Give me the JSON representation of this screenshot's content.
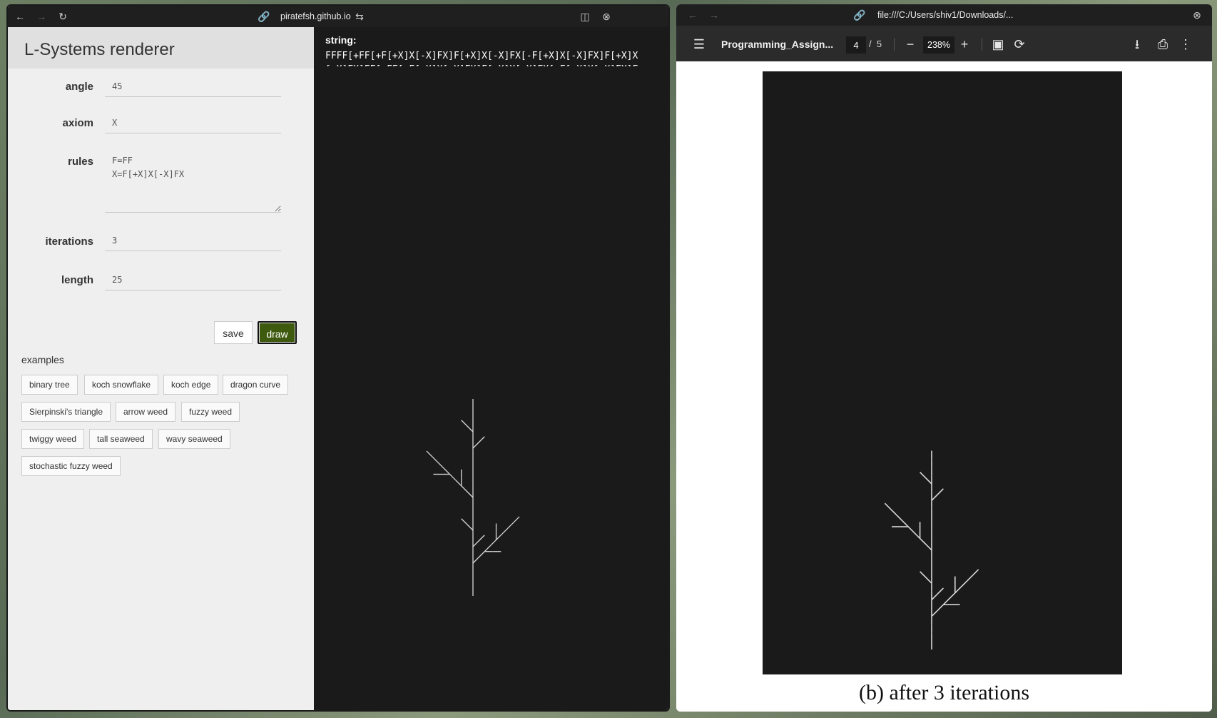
{
  "left_window": {
    "url": "piratefsh.github.io",
    "icons": [
      "back-arrow-icon",
      "forward-arrow-icon",
      "reload-icon",
      "link-icon",
      "tune-icon",
      "split-view-icon",
      "close-circle-icon"
    ]
  },
  "app": {
    "title": "L-Systems renderer",
    "angle": {
      "label": "angle",
      "value": "45"
    },
    "axiom": {
      "label": "axiom",
      "value": "X"
    },
    "rules": {
      "label": "rules",
      "value": "F=FF\nX=F[+X]X[-X]FX"
    },
    "iterations": {
      "label": "iterations",
      "value": "3"
    },
    "length": {
      "label": "length",
      "value": "25"
    },
    "save_label": "save",
    "draw_label": "draw",
    "examples_label": "examples",
    "examples": [
      "binary tree",
      "koch snowflake",
      "koch edge",
      "dragon curve",
      "Sierpinski's triangle",
      "arrow weed",
      "fuzzy weed",
      "twiggy weed",
      "tall seaweed",
      "wavy seaweed",
      "stochastic fuzzy weed"
    ],
    "string_label": "string:",
    "string_value": "FFFF[+FF[+F[+X]X[-X]FX]F[+X]X[-X]FX[-F[+X]X[-X]FX]F[+X]X[-X]FX]FF[-FF[+F[+X]X[-X]FX]F[+X]X[-X]FX[-F[+X]X[-X]FX]F[+X]X[-X]FX]FF"
  },
  "right_window": {
    "url": "file:///C:/Users/shiv1/Downloads/...",
    "doc_title": "Programming_Assign...",
    "page": "4",
    "page_sep": "/",
    "total_pages": "5",
    "zoom": "238%",
    "caption": "(b) after 3 iterations"
  },
  "lsystem": {
    "axiom": "X",
    "rules": {
      "F": "FF",
      "X": "F[+X]X[-X]FX"
    },
    "iterations": 3,
    "angle_deg": 45,
    "color": "#d9d9d9"
  },
  "colors": {
    "canvas_bg": "#1a1a1a",
    "draw_button": "#3d5a0f",
    "titlebar": "#1f1f1f",
    "pdf_toolbar": "#2b2b2b"
  }
}
